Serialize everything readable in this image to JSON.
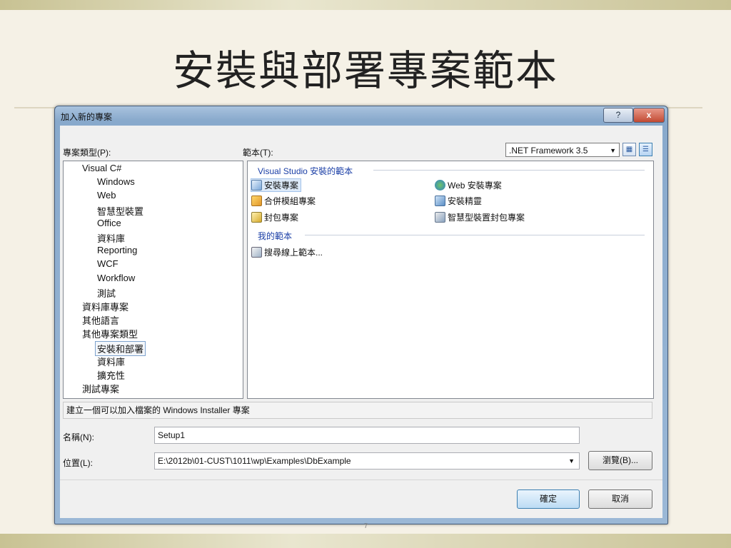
{
  "slide": {
    "title": "安裝與部署專案範本",
    "page_number": "7"
  },
  "dialog": {
    "title": "加入新的專案",
    "help_label": "?",
    "close_label": "x",
    "project_types_label": "專案類型(P):",
    "templates_label": "範本(T):",
    "framework": ".NET Framework 3.5",
    "tree": [
      {
        "label": "Visual C#",
        "level": 1
      },
      {
        "label": "Windows",
        "level": 2
      },
      {
        "label": "Web",
        "level": 2
      },
      {
        "label": "智慧型裝置",
        "level": 2
      },
      {
        "label": "Office",
        "level": 2
      },
      {
        "label": "資料庫",
        "level": 2
      },
      {
        "label": "Reporting",
        "level": 2
      },
      {
        "label": "WCF",
        "level": 2
      },
      {
        "label": "Workflow",
        "level": 2
      },
      {
        "label": "測試",
        "level": 2
      },
      {
        "label": "資料庫專案",
        "level": 1
      },
      {
        "label": "其他語言",
        "level": 1
      },
      {
        "label": "其他專案類型",
        "level": 1
      },
      {
        "label": "安裝和部署",
        "level": 2,
        "selected": true
      },
      {
        "label": "資料庫",
        "level": 2
      },
      {
        "label": "擴充性",
        "level": 2
      },
      {
        "label": "測試專案",
        "level": 1
      }
    ],
    "groups": [
      {
        "header": "Visual Studio 安裝的範本",
        "templates": [
          {
            "label": "安裝專案",
            "icon": "setup-project-icon",
            "selected": true
          },
          {
            "label": "Web 安裝專案",
            "icon": "web-setup-icon"
          },
          {
            "label": "合併模組專案",
            "icon": "merge-module-icon"
          },
          {
            "label": "安裝精靈",
            "icon": "setup-wizard-icon"
          },
          {
            "label": "封包專案",
            "icon": "cab-project-icon"
          },
          {
            "label": "智慧型裝置封包專案",
            "icon": "smart-device-cab-icon"
          }
        ]
      },
      {
        "header": "我的範本",
        "templates": [
          {
            "label": "搜尋線上範本...",
            "icon": "search-online-templates-icon"
          }
        ]
      }
    ],
    "description": "建立一個可以加入檔案的 Windows Installer 專案",
    "name_label": "名稱(N):",
    "name_value": "Setup1",
    "location_label": "位置(L):",
    "location_value": "E:\\2012b\\01-CUST\\1011\\wp\\Examples\\DbExample",
    "browse_label": "瀏覽(B)...",
    "ok_label": "確定",
    "cancel_label": "取消"
  }
}
